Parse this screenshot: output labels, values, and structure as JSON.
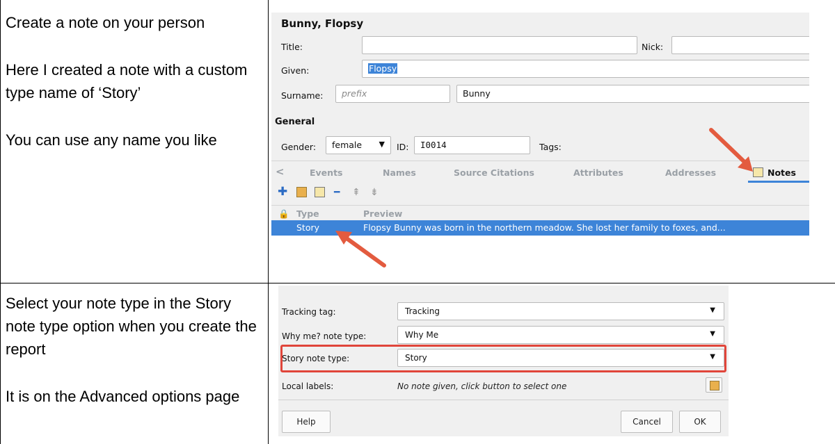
{
  "row1": {
    "paragraphs": [
      "Create a note on your person",
      "Here I created a note with a custom type name of ‘Story’",
      "You can use any name you like"
    ]
  },
  "row2": {
    "paragraphs": [
      "Select your note type in the Story note type option when you create the report",
      "It is on the Advanced options page"
    ]
  },
  "editor": {
    "person_name": "Bunny, Flopsy",
    "title_label": "Title:",
    "title_value": "",
    "nick_label": "Nick:",
    "nick_value": "",
    "given_label": "Given:",
    "given_value": "Flopsy",
    "surname_label": "Surname:",
    "prefix_placeholder": "prefix",
    "surname_value": "Bunny",
    "general_heading": "General",
    "gender_label": "Gender:",
    "gender_value": "female",
    "id_label": "ID:",
    "id_value": "I0014",
    "tags_label": "Tags:",
    "tabs": [
      "Events",
      "Names",
      "Source Citations",
      "Attributes",
      "Addresses",
      "Notes"
    ],
    "active_tab": "Notes",
    "columns": [
      "Type",
      "Preview"
    ],
    "rows": [
      {
        "type": "Story",
        "preview": "Flopsy Bunny was born in the northern meadow.  She lost her family to foxes, and..."
      }
    ]
  },
  "report_options": {
    "rows": [
      {
        "label": "Tracking tag:",
        "value": "Tracking"
      },
      {
        "label": "Why me? note type:",
        "value": "Why Me"
      },
      {
        "label": "Story note type:",
        "value": "Story"
      }
    ],
    "local_labels_label": "Local labels:",
    "local_labels_value": "No note given, click button to select one",
    "help_label": "Help",
    "cancel_label": "Cancel",
    "ok_label": "OK"
  },
  "colors": {
    "selection": "#3d84d8",
    "arrow": "#e35b3f",
    "highlight_box": "#e0453a"
  }
}
